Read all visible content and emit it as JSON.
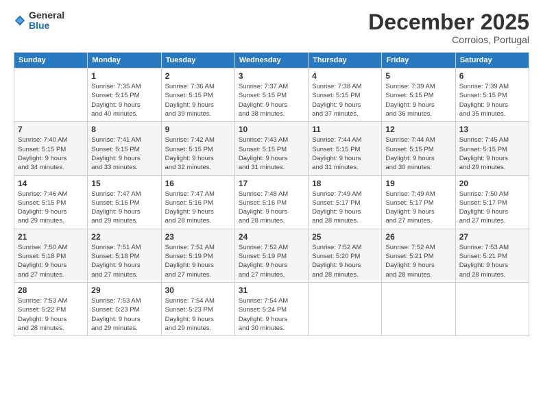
{
  "header": {
    "logo": {
      "line1": "General",
      "line2": "Blue"
    },
    "title": "December 2025",
    "subtitle": "Corroios, Portugal"
  },
  "weekdays": [
    "Sunday",
    "Monday",
    "Tuesday",
    "Wednesday",
    "Thursday",
    "Friday",
    "Saturday"
  ],
  "weeks": [
    [
      {
        "day": "",
        "info": ""
      },
      {
        "day": "1",
        "info": "Sunrise: 7:35 AM\nSunset: 5:15 PM\nDaylight: 9 hours\nand 40 minutes."
      },
      {
        "day": "2",
        "info": "Sunrise: 7:36 AM\nSunset: 5:15 PM\nDaylight: 9 hours\nand 39 minutes."
      },
      {
        "day": "3",
        "info": "Sunrise: 7:37 AM\nSunset: 5:15 PM\nDaylight: 9 hours\nand 38 minutes."
      },
      {
        "day": "4",
        "info": "Sunrise: 7:38 AM\nSunset: 5:15 PM\nDaylight: 9 hours\nand 37 minutes."
      },
      {
        "day": "5",
        "info": "Sunrise: 7:39 AM\nSunset: 5:15 PM\nDaylight: 9 hours\nand 36 minutes."
      },
      {
        "day": "6",
        "info": "Sunrise: 7:39 AM\nSunset: 5:15 PM\nDaylight: 9 hours\nand 35 minutes."
      }
    ],
    [
      {
        "day": "7",
        "info": "Sunrise: 7:40 AM\nSunset: 5:15 PM\nDaylight: 9 hours\nand 34 minutes."
      },
      {
        "day": "8",
        "info": "Sunrise: 7:41 AM\nSunset: 5:15 PM\nDaylight: 9 hours\nand 33 minutes."
      },
      {
        "day": "9",
        "info": "Sunrise: 7:42 AM\nSunset: 5:15 PM\nDaylight: 9 hours\nand 32 minutes."
      },
      {
        "day": "10",
        "info": "Sunrise: 7:43 AM\nSunset: 5:15 PM\nDaylight: 9 hours\nand 31 minutes."
      },
      {
        "day": "11",
        "info": "Sunrise: 7:44 AM\nSunset: 5:15 PM\nDaylight: 9 hours\nand 31 minutes."
      },
      {
        "day": "12",
        "info": "Sunrise: 7:44 AM\nSunset: 5:15 PM\nDaylight: 9 hours\nand 30 minutes."
      },
      {
        "day": "13",
        "info": "Sunrise: 7:45 AM\nSunset: 5:15 PM\nDaylight: 9 hours\nand 29 minutes."
      }
    ],
    [
      {
        "day": "14",
        "info": "Sunrise: 7:46 AM\nSunset: 5:15 PM\nDaylight: 9 hours\nand 29 minutes."
      },
      {
        "day": "15",
        "info": "Sunrise: 7:47 AM\nSunset: 5:16 PM\nDaylight: 9 hours\nand 29 minutes."
      },
      {
        "day": "16",
        "info": "Sunrise: 7:47 AM\nSunset: 5:16 PM\nDaylight: 9 hours\nand 28 minutes."
      },
      {
        "day": "17",
        "info": "Sunrise: 7:48 AM\nSunset: 5:16 PM\nDaylight: 9 hours\nand 28 minutes."
      },
      {
        "day": "18",
        "info": "Sunrise: 7:49 AM\nSunset: 5:17 PM\nDaylight: 9 hours\nand 28 minutes."
      },
      {
        "day": "19",
        "info": "Sunrise: 7:49 AM\nSunset: 5:17 PM\nDaylight: 9 hours\nand 27 minutes."
      },
      {
        "day": "20",
        "info": "Sunrise: 7:50 AM\nSunset: 5:17 PM\nDaylight: 9 hours\nand 27 minutes."
      }
    ],
    [
      {
        "day": "21",
        "info": "Sunrise: 7:50 AM\nSunset: 5:18 PM\nDaylight: 9 hours\nand 27 minutes."
      },
      {
        "day": "22",
        "info": "Sunrise: 7:51 AM\nSunset: 5:18 PM\nDaylight: 9 hours\nand 27 minutes."
      },
      {
        "day": "23",
        "info": "Sunrise: 7:51 AM\nSunset: 5:19 PM\nDaylight: 9 hours\nand 27 minutes."
      },
      {
        "day": "24",
        "info": "Sunrise: 7:52 AM\nSunset: 5:19 PM\nDaylight: 9 hours\nand 27 minutes."
      },
      {
        "day": "25",
        "info": "Sunrise: 7:52 AM\nSunset: 5:20 PM\nDaylight: 9 hours\nand 28 minutes."
      },
      {
        "day": "26",
        "info": "Sunrise: 7:52 AM\nSunset: 5:21 PM\nDaylight: 9 hours\nand 28 minutes."
      },
      {
        "day": "27",
        "info": "Sunrise: 7:53 AM\nSunset: 5:21 PM\nDaylight: 9 hours\nand 28 minutes."
      }
    ],
    [
      {
        "day": "28",
        "info": "Sunrise: 7:53 AM\nSunset: 5:22 PM\nDaylight: 9 hours\nand 28 minutes."
      },
      {
        "day": "29",
        "info": "Sunrise: 7:53 AM\nSunset: 5:23 PM\nDaylight: 9 hours\nand 29 minutes."
      },
      {
        "day": "30",
        "info": "Sunrise: 7:54 AM\nSunset: 5:23 PM\nDaylight: 9 hours\nand 29 minutes."
      },
      {
        "day": "31",
        "info": "Sunrise: 7:54 AM\nSunset: 5:24 PM\nDaylight: 9 hours\nand 30 minutes."
      },
      {
        "day": "",
        "info": ""
      },
      {
        "day": "",
        "info": ""
      },
      {
        "day": "",
        "info": ""
      }
    ]
  ]
}
